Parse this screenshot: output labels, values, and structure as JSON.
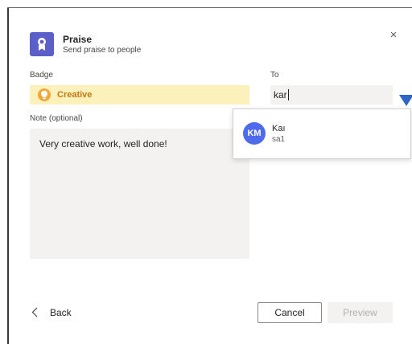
{
  "dialog": {
    "title": "Praise",
    "subtitle": "Send praise to people",
    "close_glyph": "×",
    "icons": {
      "app": "praise-ribbon-icon",
      "close": "close-icon"
    }
  },
  "badge": {
    "label": "Badge",
    "value": "Creative",
    "icon": "lightbulb-icon",
    "background_color": "#fdf1bb",
    "text_color": "#c07a11"
  },
  "to": {
    "label": "To",
    "value": "kar"
  },
  "note": {
    "label": "Note (optional)",
    "value": "Very creative work, well done!"
  },
  "suggestions": [
    {
      "initials": "KM",
      "name": "Kaı",
      "subtitle": "sa1",
      "avatar_color": "#4f6bed"
    }
  ],
  "footer": {
    "back_label": "Back",
    "back_icon": "chevron-left-icon",
    "cancel_label": "Cancel",
    "preview_label": "Preview"
  },
  "colors": {
    "accent": "#5b5fc7",
    "annotation_arrow": "#2f66c4"
  }
}
